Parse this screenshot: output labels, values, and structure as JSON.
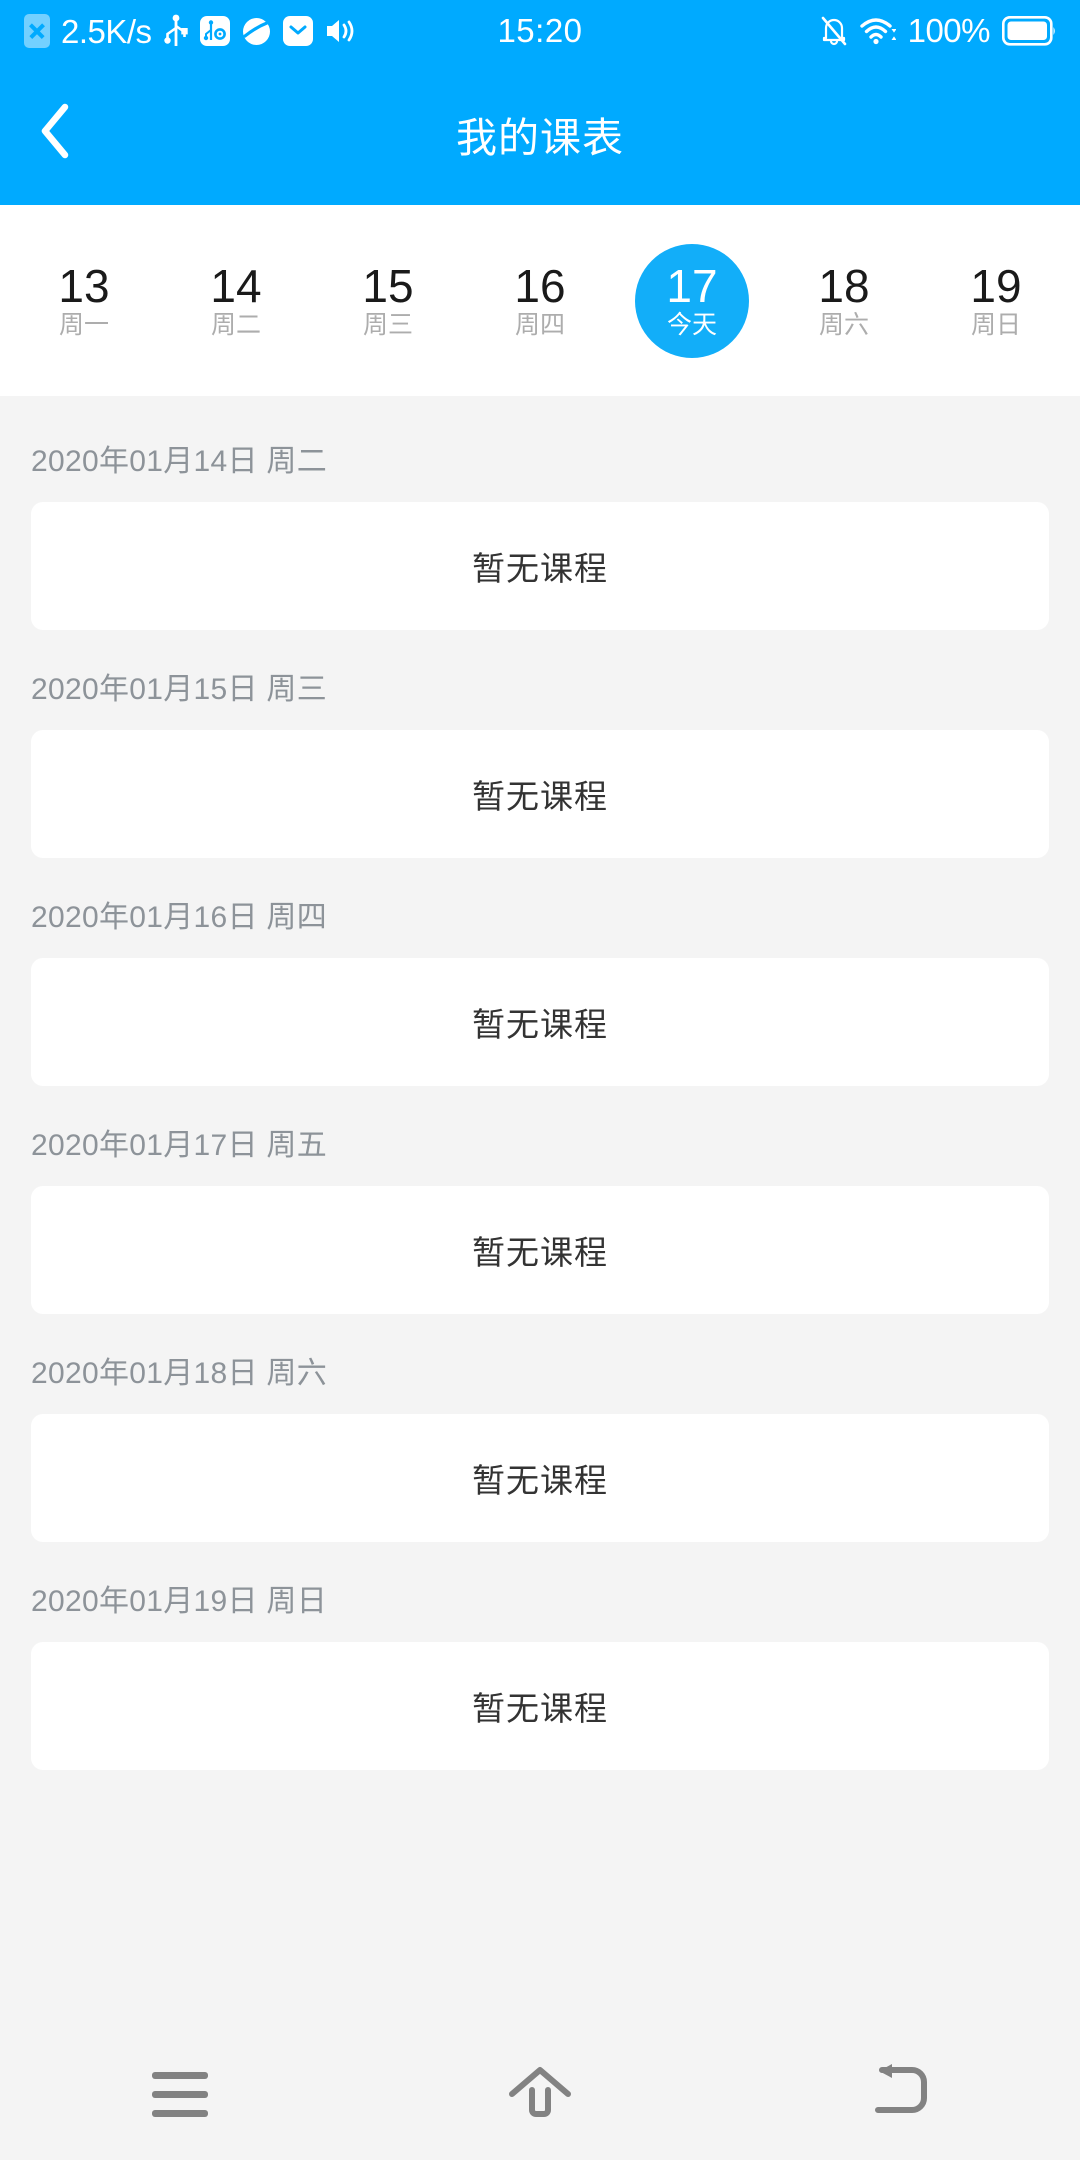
{
  "status_bar": {
    "network_speed": "2.5K/s",
    "clock": "15:20",
    "battery_percent": "100%",
    "left_icons": [
      "sim-card-x-icon",
      "usb-icon",
      "usb-debug-settings-icon",
      "browser-icon",
      "mail-icon",
      "volume-icon"
    ],
    "right_icons": [
      "notifications-off-icon",
      "wifi-icon",
      "battery-full-icon"
    ],
    "background_color": "#00AAFF"
  },
  "header": {
    "title": "我的课表",
    "back_icon": "chevron-left-icon",
    "background_color": "#00AAFF",
    "text_color": "#FFFFFF"
  },
  "week_strip": {
    "selected_index": 4,
    "selected_color": "#12AEF9",
    "days": [
      {
        "num": "13",
        "name": "周一",
        "selected": false
      },
      {
        "num": "14",
        "name": "周二",
        "selected": false
      },
      {
        "num": "15",
        "name": "周三",
        "selected": false
      },
      {
        "num": "16",
        "name": "周四",
        "selected": false
      },
      {
        "num": "17",
        "name": "今天",
        "selected": true
      },
      {
        "num": "18",
        "name": "周六",
        "selected": false
      },
      {
        "num": "19",
        "name": "周日",
        "selected": false
      }
    ]
  },
  "schedule": {
    "empty_label": "暂无课程",
    "groups": [
      {
        "date": "2020年01月14日 周二",
        "courses": []
      },
      {
        "date": "2020年01月15日 周三",
        "courses": []
      },
      {
        "date": "2020年01月16日 周四",
        "courses": []
      },
      {
        "date": "2020年01月17日 周五",
        "courses": []
      },
      {
        "date": "2020年01月18日 周六",
        "courses": []
      },
      {
        "date": "2020年01月19日 周日",
        "courses": []
      }
    ]
  },
  "nav_bar": {
    "buttons": [
      {
        "icon": "menu-icon",
        "name": "recents-button"
      },
      {
        "icon": "home-icon",
        "name": "home-button"
      },
      {
        "icon": "back-icon",
        "name": "back-button"
      }
    ],
    "icon_color": "#828282"
  }
}
